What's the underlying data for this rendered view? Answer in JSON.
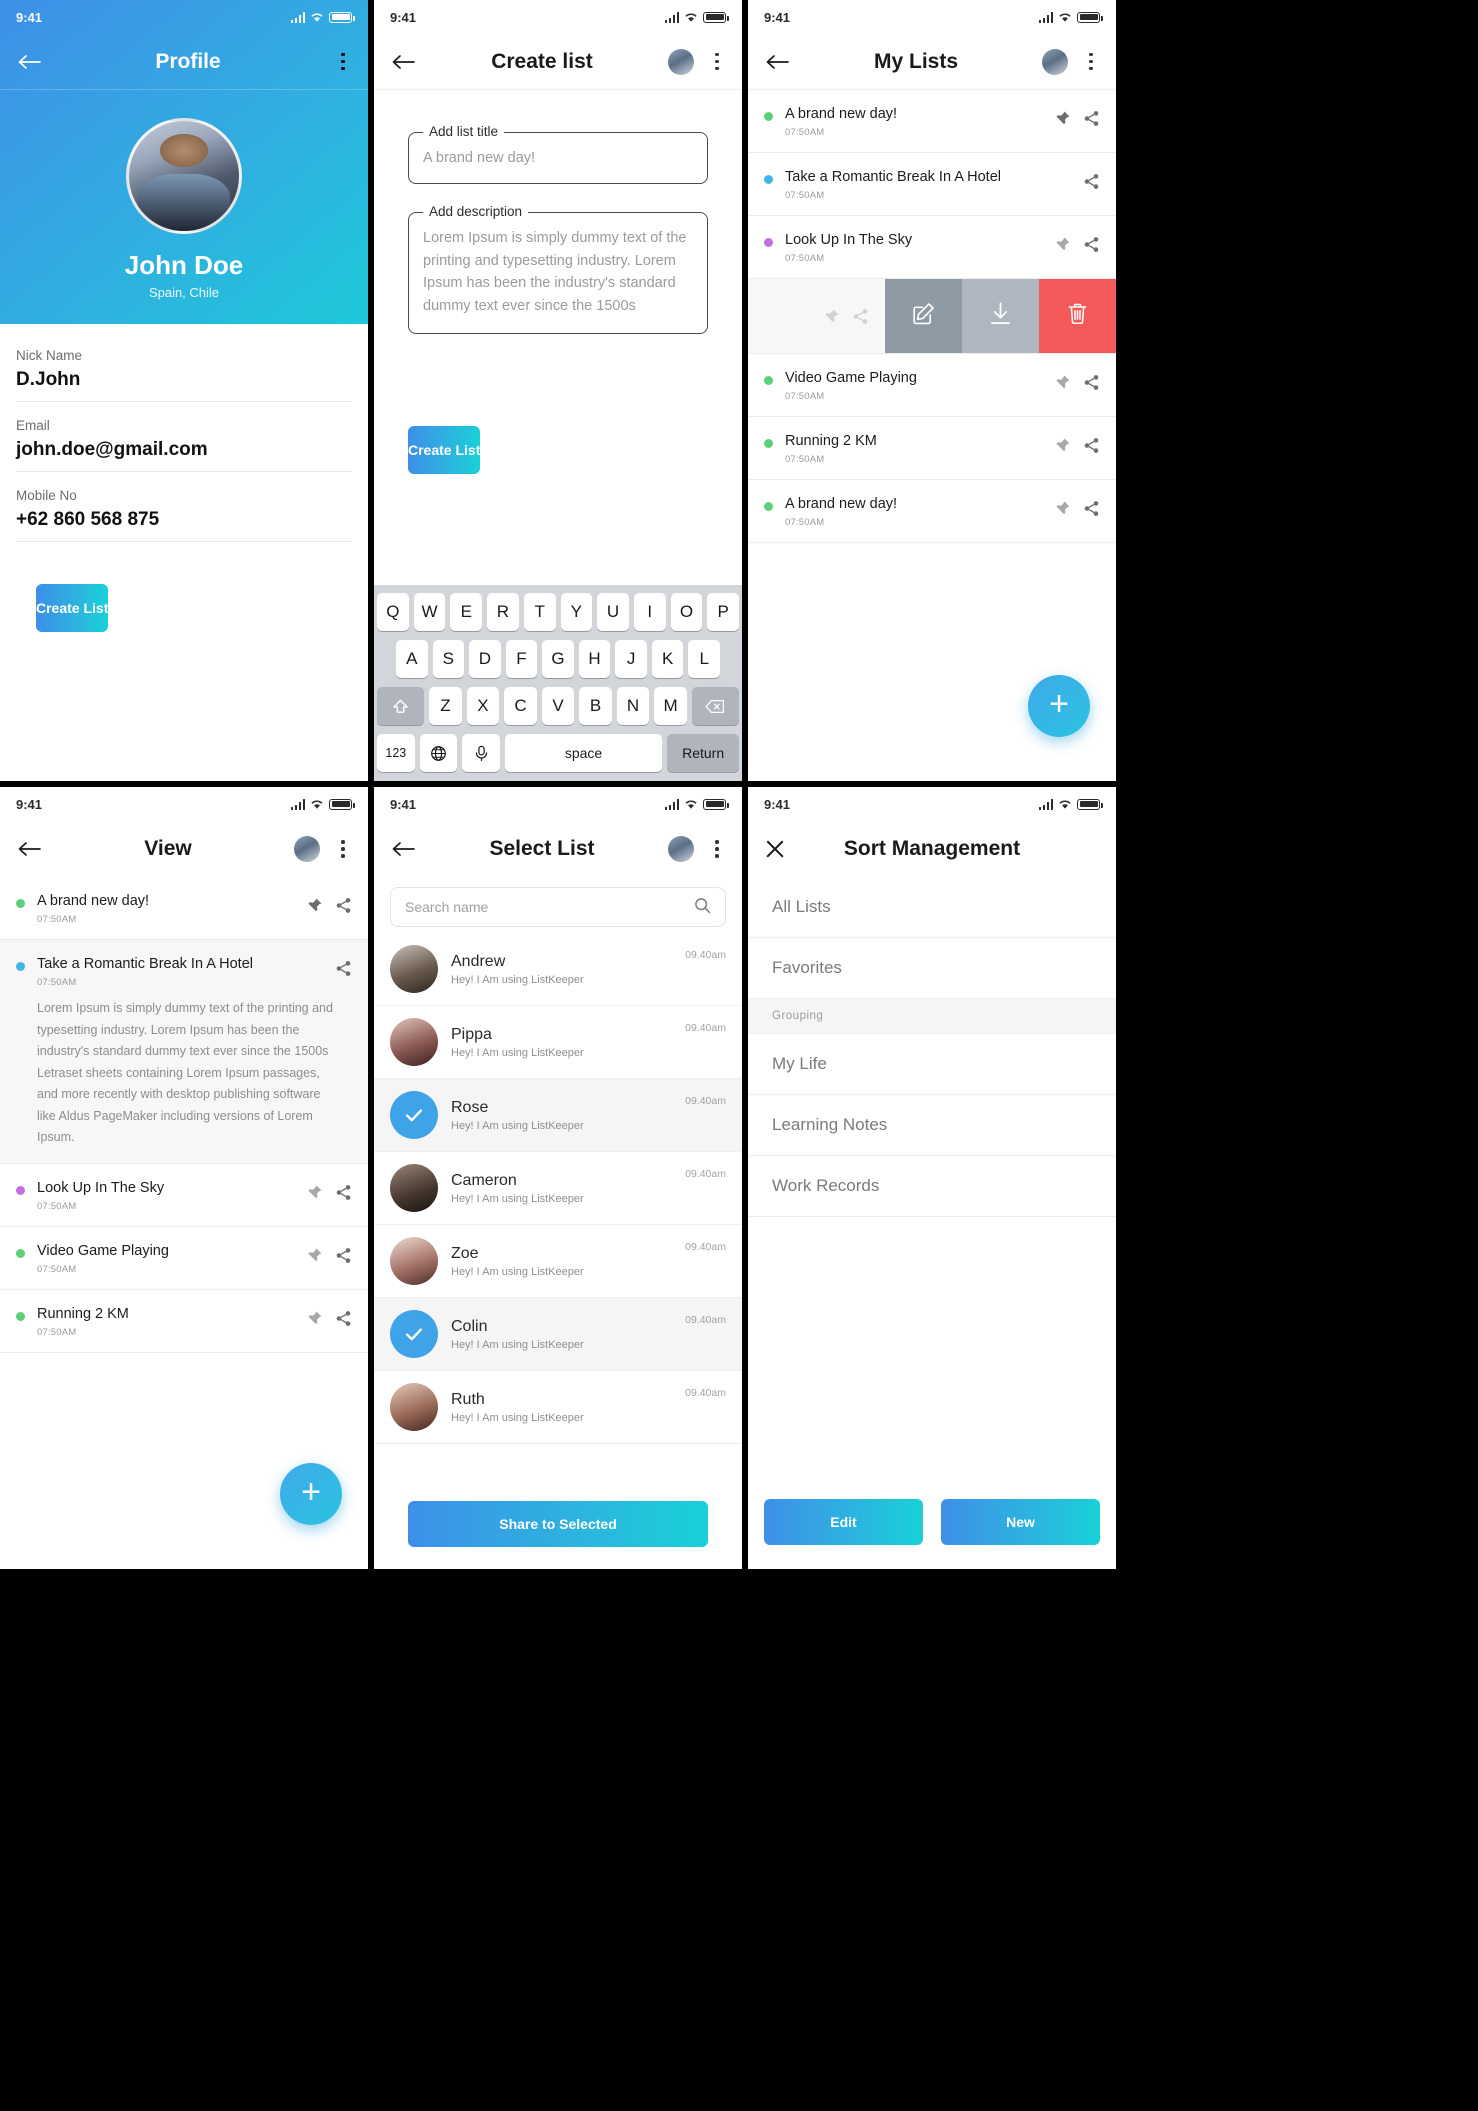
{
  "status_bar": {
    "time": "9:41"
  },
  "colors": {
    "accent_start": "#3E8FE8",
    "accent_end": "#18D1D8",
    "dot_green": "#5BD078",
    "dot_blue": "#3FB6E8",
    "dot_purple": "#C071E0",
    "swipe_edit_bg": "#8E9AA4",
    "swipe_download_bg": "#AEB7BF",
    "swipe_delete_bg": "#F55A5A",
    "check_blue": "#3FA3E8"
  },
  "profile_screen": {
    "title": "Profile",
    "back_icon": "arrow-left-icon",
    "menu_icon": "kebab-menu-icon",
    "name": "John Doe",
    "location": "Spain, Chile",
    "fields": [
      {
        "label": "Nick Name",
        "value": "D.John"
      },
      {
        "label": "Email",
        "value": "john.doe@gmail.com"
      },
      {
        "label": "Mobile No",
        "value": "+62 860 568 875"
      }
    ],
    "cta_label": "Create List"
  },
  "create_list_screen": {
    "title": "Create list",
    "back_icon": "arrow-left-icon",
    "avatar_icon": "user-avatar",
    "menu_icon": "kebab-menu-icon",
    "title_field": {
      "legend": "Add list title",
      "placeholder": "A brand new day!",
      "value": ""
    },
    "desc_field": {
      "legend": "Add description",
      "placeholder": "Lorem Ipsum is simply dummy text of the printing and typesetting industry. Lorem Ipsum has been the industry's standard dummy text ever since the 1500s",
      "value": ""
    },
    "cta_label": "Create List",
    "keyboard": {
      "row1": [
        "Q",
        "W",
        "E",
        "R",
        "T",
        "Y",
        "U",
        "I",
        "O",
        "P"
      ],
      "row2": [
        "A",
        "S",
        "D",
        "F",
        "G",
        "H",
        "J",
        "K",
        "L"
      ],
      "row3": [
        "Z",
        "X",
        "C",
        "V",
        "B",
        "N",
        "M"
      ],
      "shift_icon": "shift-icon",
      "backspace_icon": "backspace-icon",
      "numbers_label": "123",
      "globe_icon": "globe-icon",
      "mic_icon": "microphone-icon",
      "space_label": "space",
      "return_label": "Return"
    }
  },
  "my_lists_screen": {
    "title": "My Lists",
    "back_icon": "arrow-left-icon",
    "avatar_icon": "user-avatar",
    "menu_icon": "kebab-menu-icon",
    "items": [
      {
        "title": "A brand new day!",
        "time": "07:50AM",
        "dot": "#5BD078",
        "pin": true,
        "share": true
      },
      {
        "title": "Take a Romantic Break In A Hotel",
        "time": "07:50AM",
        "dot": "#3FB6E8",
        "pin": false,
        "share": true
      },
      {
        "title": "Look Up In The Sky",
        "time": "07:50AM",
        "dot": "#C071E0",
        "pin": true,
        "share": true
      },
      {
        "title": "Video Game Playing",
        "time": "07:50AM",
        "dot": "#5BD078",
        "pin": true,
        "share": true
      },
      {
        "title": "Running 2 KM",
        "time": "07:50AM",
        "dot": "#5BD078",
        "pin": true,
        "share": true
      },
      {
        "title": "A brand new day!",
        "time": "07:50AM",
        "dot": "#5BD078",
        "pin": true,
        "share": true
      }
    ],
    "swipe_actions": [
      {
        "name": "edit",
        "icon": "edit-pencil-icon",
        "bg": "#8E9AA4"
      },
      {
        "name": "download",
        "icon": "download-icon",
        "bg": "#AEB7BF"
      },
      {
        "name": "delete",
        "icon": "trash-icon",
        "bg": "#F55A5A"
      }
    ],
    "fab_label": "+"
  },
  "view_screen": {
    "title": "View",
    "back_icon": "arrow-left-icon",
    "avatar_icon": "user-avatar",
    "menu_icon": "kebab-menu-icon",
    "items": [
      {
        "title": "A brand new day!",
        "time": "07:50AM",
        "dot": "#5BD078",
        "pin": true,
        "share": true,
        "expanded": false
      },
      {
        "title": "Take a Romantic Break In A Hotel",
        "time": "07:50AM",
        "dot": "#3FB6E8",
        "pin": false,
        "share": true,
        "expanded": true,
        "description": "Lorem Ipsum is simply dummy text of the printing and typesetting industry. Lorem Ipsum has been the industry's standard dummy text ever since the 1500s Letraset sheets containing Lorem Ipsum passages, and more recently with desktop publishing software like Aldus PageMaker including versions of Lorem Ipsum."
      },
      {
        "title": "Look Up In The Sky",
        "time": "07:50AM",
        "dot": "#C071E0",
        "pin": true,
        "share": true,
        "expanded": false
      },
      {
        "title": "Video Game Playing",
        "time": "07:50AM",
        "dot": "#5BD078",
        "pin": true,
        "share": true,
        "expanded": false
      },
      {
        "title": "Running 2 KM",
        "time": "07:50AM",
        "dot": "#5BD078",
        "pin": true,
        "share": true,
        "expanded": false
      }
    ],
    "fab_label": "+"
  },
  "select_list_screen": {
    "title": "Select List",
    "back_icon": "arrow-left-icon",
    "avatar_icon": "user-avatar",
    "menu_icon": "kebab-menu-icon",
    "search": {
      "placeholder": "Search name",
      "value": "",
      "icon": "search-icon"
    },
    "contacts": [
      {
        "name": "Andrew",
        "message": "Hey! I Am using ListKeeper",
        "time": "09.40am",
        "selected": false,
        "avatar": "#6B5B4E"
      },
      {
        "name": "Pippa",
        "message": "Hey! I Am using ListKeeper",
        "time": "09.40am",
        "selected": false,
        "avatar": "#8E5A55"
      },
      {
        "name": "Rose",
        "message": "Hey! I Am using ListKeeper",
        "time": "09.40am",
        "selected": true,
        "avatar": "#3FA3E8"
      },
      {
        "name": "Cameron",
        "message": "Hey! I Am using ListKeeper",
        "time": "09.40am",
        "selected": false,
        "avatar": "#4A3B33"
      },
      {
        "name": "Zoe",
        "message": "Hey! I Am using ListKeeper",
        "time": "09.40am",
        "selected": false,
        "avatar": "#A8746B"
      },
      {
        "name": "Colin",
        "message": "Hey! I Am using ListKeeper",
        "time": "09.40am",
        "selected": true,
        "avatar": "#3FA3E8"
      },
      {
        "name": "Ruth",
        "message": "Hey! I Am using ListKeeper",
        "time": "09.40am",
        "selected": false,
        "avatar": "#9C6B5A"
      }
    ],
    "cta_label": "Share to Selected"
  },
  "sort_management_screen": {
    "title": "Sort Management",
    "close_icon": "close-x-icon",
    "rows": [
      {
        "label": "All Lists",
        "type": "item"
      },
      {
        "label": "Favorites",
        "type": "item"
      },
      {
        "label": "Grouping",
        "type": "group"
      },
      {
        "label": "My Life",
        "type": "item"
      },
      {
        "label": "Learning Notes",
        "type": "item"
      },
      {
        "label": "Work Records",
        "type": "item"
      }
    ],
    "buttons": [
      {
        "label": "Edit"
      },
      {
        "label": "New"
      }
    ]
  }
}
